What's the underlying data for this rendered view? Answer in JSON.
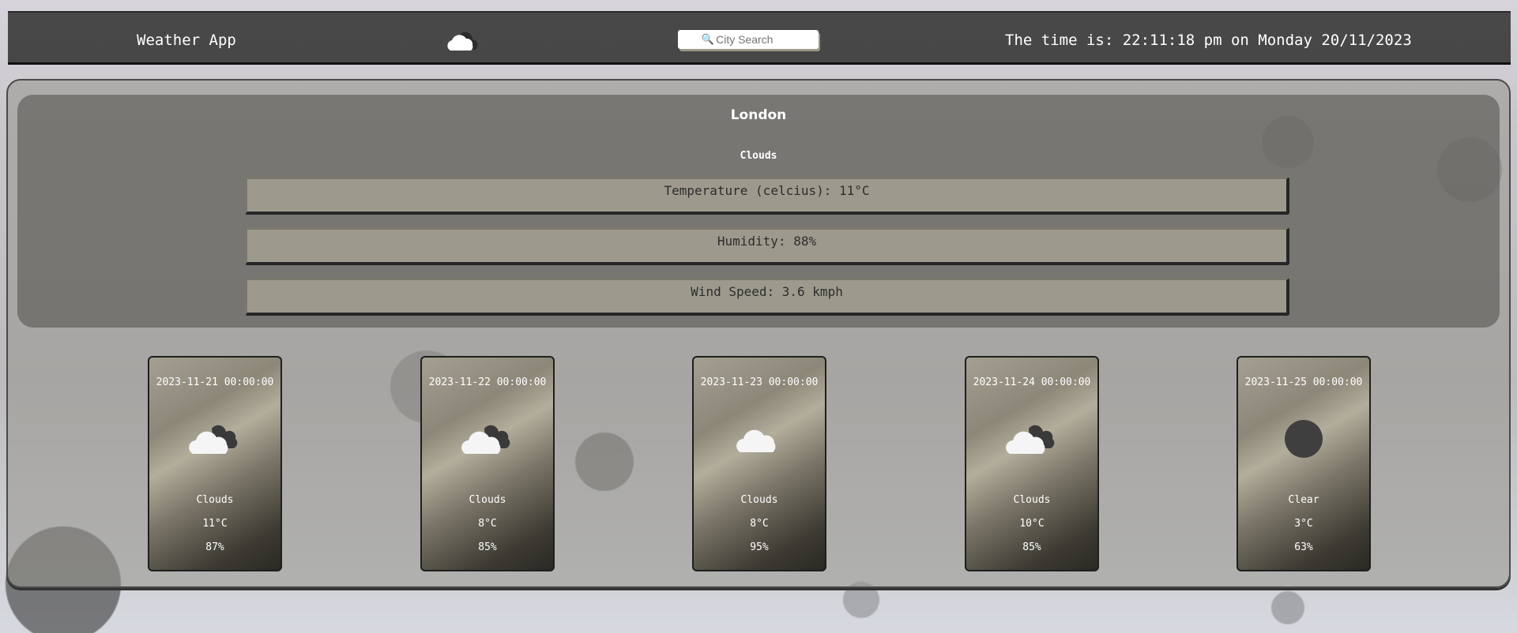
{
  "header": {
    "app_title": "Weather App",
    "logo_icon": "cloud-icon",
    "search_placeholder": "City Search",
    "clock_text": "The time is: 22:11:18 pm on Monday 20/11/2023"
  },
  "current": {
    "city": "London",
    "condition": "Clouds",
    "temperature": "Temperature (celcius): 11°C",
    "humidity": "Humidity: 88%",
    "wind": "Wind Speed: 3.6 kmph"
  },
  "forecast": [
    {
      "date": "2023-11-21 00:00:00",
      "icon": "broken-clouds-icon",
      "condition": "Clouds",
      "temp": "11°C",
      "humidity": "87%"
    },
    {
      "date": "2023-11-22 00:00:00",
      "icon": "broken-clouds-icon",
      "condition": "Clouds",
      "temp": "8°C",
      "humidity": "85%"
    },
    {
      "date": "2023-11-23 00:00:00",
      "icon": "cloud-icon",
      "condition": "Clouds",
      "temp": "8°C",
      "humidity": "95%"
    },
    {
      "date": "2023-11-24 00:00:00",
      "icon": "broken-clouds-icon",
      "condition": "Clouds",
      "temp": "10°C",
      "humidity": "85%"
    },
    {
      "date": "2023-11-25 00:00:00",
      "icon": "clear-sky-icon",
      "condition": "Clear",
      "temp": "3°C",
      "humidity": "63%"
    }
  ],
  "colors": {
    "topbar": "#343434",
    "stat_box": "#9d9a8d",
    "panel": "#64625e"
  }
}
